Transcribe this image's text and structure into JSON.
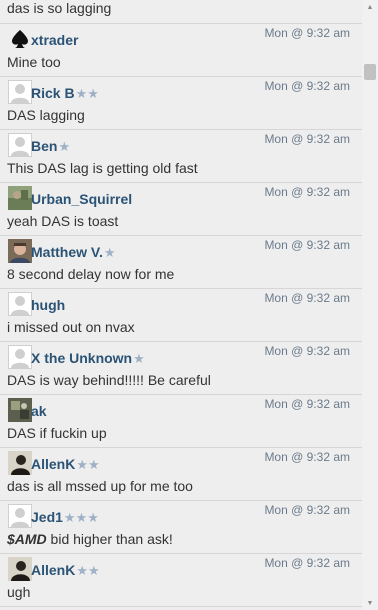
{
  "top_partial": {
    "text": "das is so lagging"
  },
  "messages": [
    {
      "user": "xtrader",
      "stars": "",
      "time": "Mon @ 9:32 am",
      "text": "Mine too",
      "avatar": "spade"
    },
    {
      "user": "Rick B",
      "stars": "★★",
      "time": "Mon @ 9:32 am",
      "text": "DAS lagging",
      "avatar": "default"
    },
    {
      "user": "Ben",
      "stars": "★",
      "time": "Mon @ 9:32 am",
      "text": "This DAS lag is getting old fast",
      "avatar": "default"
    },
    {
      "user": "Urban_Squirrel",
      "stars": "",
      "time": "Mon @ 9:32 am",
      "text": "yeah DAS is toast",
      "avatar": "photo-outdoor"
    },
    {
      "user": "Matthew V.",
      "stars": "★",
      "time": "Mon @ 9:32 am",
      "text": "8 second delay now for me",
      "avatar": "photo-face"
    },
    {
      "user": "hugh",
      "stars": "",
      "time": "Mon @ 9:32 am",
      "text": "i missed out on nvax",
      "avatar": "default"
    },
    {
      "user": "X the Unknown",
      "stars": "★",
      "time": "Mon @ 9:32 am",
      "text": "DAS is way behind!!!!! Be careful",
      "avatar": "default"
    },
    {
      "user": "ak",
      "stars": "",
      "time": "Mon @ 9:32 am",
      "text": "DAS if fuckin up",
      "avatar": "photo-dark"
    },
    {
      "user": "AllenK",
      "stars": "★★",
      "time": "Mon @ 9:32 am",
      "text": "das is all mssed up for me too",
      "avatar": "photo-person"
    },
    {
      "user": "Jed1",
      "stars": "★★★",
      "time": "Mon @ 9:32 am",
      "text_ticker": "$AMD",
      "text": " bid higher than ask!",
      "avatar": "default"
    },
    {
      "user": "AllenK",
      "stars": "★★",
      "time": "Mon @ 9:32 am",
      "text": "ugh",
      "avatar": "photo-person"
    }
  ],
  "scrollbar": {
    "up_icon": "triangle-up",
    "down_icon": "triangle-down"
  }
}
